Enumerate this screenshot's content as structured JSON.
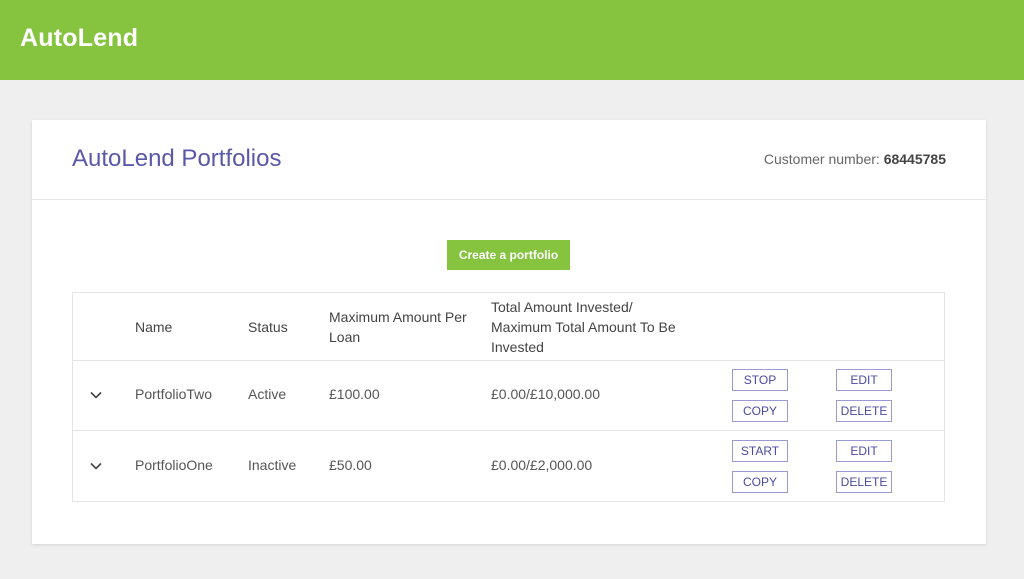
{
  "app": {
    "name": "AutoLend"
  },
  "header": {
    "title": "AutoLend Portfolios",
    "customer_label": "Customer number:",
    "customer_number": "68445785"
  },
  "create_button": "Create a portfolio",
  "table": {
    "columns": [
      "Name",
      "Status",
      "Maximum Amount Per Loan",
      "Total Amount Invested/ Maximum Total Amount To Be Invested"
    ],
    "rows": [
      {
        "name": "PortfolioTwo",
        "status": "Active",
        "max_per_loan": "£100.00",
        "total": "£0.00/£10,000.00",
        "toggle_label": "STOP",
        "edit_label": "EDIT",
        "copy_label": "COPY",
        "delete_label": "DELETE"
      },
      {
        "name": "PortfolioOne",
        "status": "Inactive",
        "max_per_loan": "£50.00",
        "total": "£0.00/£2,000.00",
        "toggle_label": "START",
        "edit_label": "EDIT",
        "copy_label": "COPY",
        "delete_label": "DELETE"
      }
    ]
  },
  "colors": {
    "brand_green": "#86c440",
    "title_purple": "#5a58a8",
    "button_border": "#9a9ad0"
  },
  "icons": {
    "expand": "chevron-down-icon"
  }
}
